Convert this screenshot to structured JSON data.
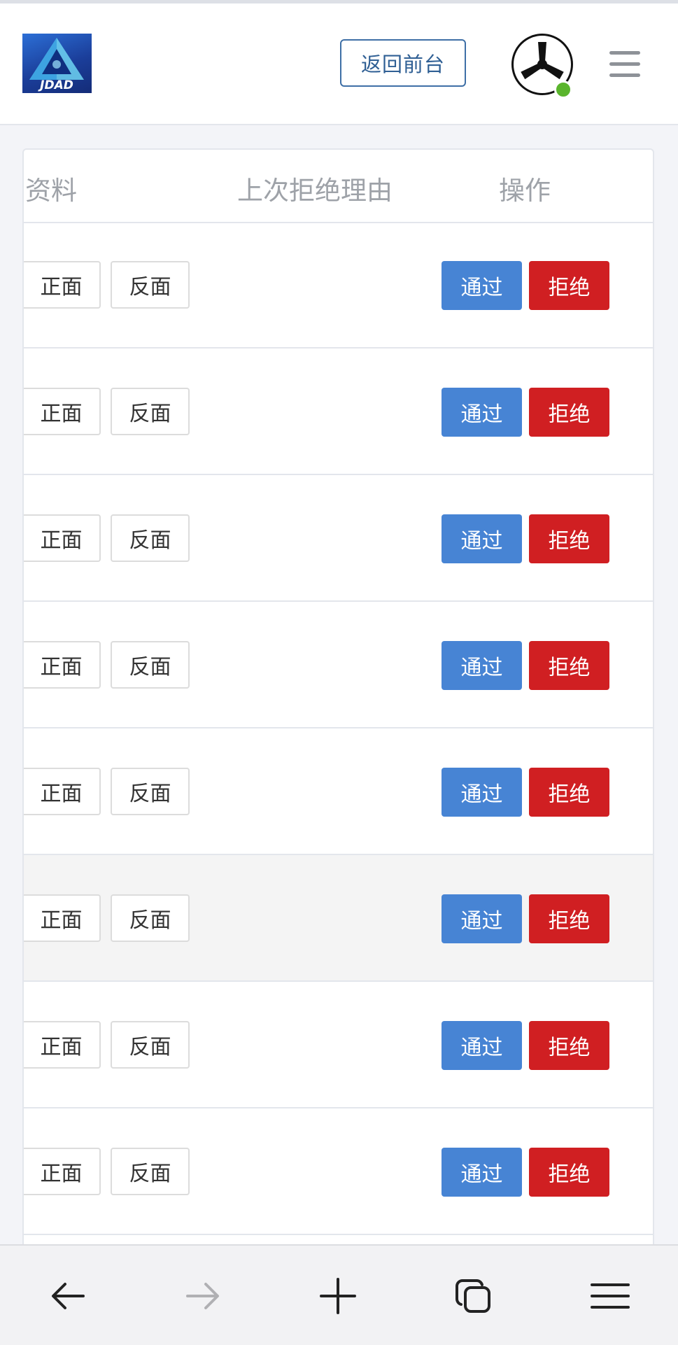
{
  "header": {
    "frontend_button_label": "返回前台",
    "logo_text": "JDAD"
  },
  "table": {
    "columns": [
      "资料",
      "上次拒绝理由",
      "操作"
    ],
    "rows": [
      {
        "front_label": "正面",
        "back_label": "反面",
        "reason": "",
        "pass_label": "通过",
        "reject_label": "拒绝"
      },
      {
        "front_label": "正面",
        "back_label": "反面",
        "reason": "",
        "pass_label": "通过",
        "reject_label": "拒绝"
      },
      {
        "front_label": "正面",
        "back_label": "反面",
        "reason": "",
        "pass_label": "通过",
        "reject_label": "拒绝"
      },
      {
        "front_label": "正面",
        "back_label": "反面",
        "reason": "",
        "pass_label": "通过",
        "reject_label": "拒绝"
      },
      {
        "front_label": "正面",
        "back_label": "反面",
        "reason": "",
        "pass_label": "通过",
        "reject_label": "拒绝"
      },
      {
        "front_label": "正面",
        "back_label": "反面",
        "reason": "",
        "pass_label": "通过",
        "reject_label": "拒绝"
      },
      {
        "front_label": "正面",
        "back_label": "反面",
        "reason": "",
        "pass_label": "通过",
        "reject_label": "拒绝"
      },
      {
        "front_label": "正面",
        "back_label": "反面",
        "reason": "",
        "pass_label": "通过",
        "reject_label": "拒绝"
      }
    ]
  },
  "colors": {
    "pass": "#4784d4",
    "reject": "#d01f22",
    "online": "#5ab52d",
    "outline_button": "#3e6fa6"
  },
  "icons": {
    "avatar": "tri-blade-avatar-icon",
    "menu": "hamburger-icon",
    "browser_nav": [
      "back-arrow-icon",
      "forward-arrow-icon",
      "new-tab-plus-icon",
      "tabs-icon",
      "browser-menu-icon"
    ]
  }
}
